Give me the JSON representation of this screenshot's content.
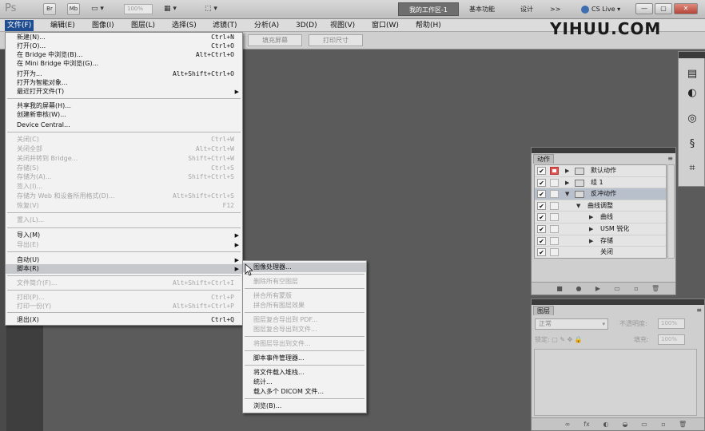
{
  "app": {
    "logo": "Ps",
    "toolbar_btns": [
      "Br",
      "Mb"
    ],
    "zoom": "100%",
    "workspace_active": "我的工作区-1",
    "workspaces": [
      "基本功能",
      "设计"
    ],
    "more": ">>",
    "cs_live": "CS Live",
    "window_buttons": [
      "—",
      "▢",
      "✕"
    ]
  },
  "watermark": "YIHUU.COM",
  "menubar": [
    "文件(F)",
    "编辑(E)",
    "图像(I)",
    "图层(L)",
    "选择(S)",
    "滤镜(T)",
    "分析(A)",
    "3D(D)",
    "视图(V)",
    "窗口(W)",
    "帮助(H)"
  ],
  "options_bar": {
    "fill_screen": "填充屏幕",
    "print_size": "打印尺寸"
  },
  "file_menu": [
    {
      "label": "新建(N)...",
      "shortcut": "Ctrl+N"
    },
    {
      "label": "打开(O)...",
      "shortcut": "Ctrl+O"
    },
    {
      "label": "在 Bridge 中浏览(B)...",
      "shortcut": "Alt+Ctrl+O"
    },
    {
      "label": "在 Mini Bridge 中浏览(G)...",
      "shortcut": ""
    },
    {
      "label": "打开为...",
      "shortcut": "Alt+Shift+Ctrl+O"
    },
    {
      "label": "打开为智能对象...",
      "shortcut": ""
    },
    {
      "label": "最近打开文件(T)",
      "shortcut": ""
    },
    {
      "label": "共享我的屏幕(H)...",
      "shortcut": ""
    },
    {
      "label": "创建新审核(W)...",
      "shortcut": ""
    },
    {
      "label": "Device Central...",
      "shortcut": ""
    },
    {
      "label": "关闭(C)",
      "shortcut": "Ctrl+W"
    },
    {
      "label": "关闭全部",
      "shortcut": "Alt+Ctrl+W"
    },
    {
      "label": "关闭并转到 Bridge...",
      "shortcut": "Shift+Ctrl+W"
    },
    {
      "label": "存储(S)",
      "shortcut": "Ctrl+S"
    },
    {
      "label": "存储为(A)...",
      "shortcut": "Shift+Ctrl+S"
    },
    {
      "label": "签入(I)...",
      "shortcut": ""
    },
    {
      "label": "存储为 Web 和设备所用格式(D)...",
      "shortcut": "Alt+Shift+Ctrl+S"
    },
    {
      "label": "恢复(V)",
      "shortcut": "F12"
    },
    {
      "label": "置入(L)...",
      "shortcut": ""
    },
    {
      "label": "导入(M)",
      "shortcut": ""
    },
    {
      "label": "导出(E)",
      "shortcut": ""
    },
    {
      "label": "自动(U)",
      "shortcut": ""
    },
    {
      "label": "脚本(R)",
      "shortcut": ""
    },
    {
      "label": "文件简介(F)...",
      "shortcut": "Alt+Shift+Ctrl+I"
    },
    {
      "label": "打印(P)...",
      "shortcut": "Ctrl+P"
    },
    {
      "label": "打印一份(Y)",
      "shortcut": "Alt+Shift+Ctrl+P"
    },
    {
      "label": "退出(X)",
      "shortcut": "Ctrl+Q"
    }
  ],
  "script_submenu": [
    "图像处理器...",
    "删除所有空图层",
    "拼合所有蒙版",
    "拼合所有图层效果",
    "图层复合导出到 PDF...",
    "图层复合导出到文件...",
    "将图层导出到文件...",
    "脚本事件管理器...",
    "将文件载入堆栈...",
    "统计...",
    "载入多个 DICOM 文件...",
    "浏览(B)..."
  ],
  "actions_panel": {
    "tab": "动作",
    "menu": "≡",
    "rows": [
      "默认动作",
      "组 1",
      "反冲动作",
      "曲线调整",
      "曲线",
      "USM 锐化",
      "存储",
      "关闭"
    ],
    "footer_icons": [
      "■",
      "●",
      "▶",
      "▭",
      "▫",
      "🗑"
    ]
  },
  "layers_panel": {
    "tab": "图层",
    "blend_mode": "正常",
    "opacity_label": "不透明度:",
    "opacity_value": "100%",
    "lock_label": "锁定:",
    "fill_label": "填充:",
    "fill_value": "100%",
    "footer_icons": [
      "∞",
      "fx",
      "◐",
      "◒",
      "▭",
      "▫",
      "🗑"
    ]
  }
}
